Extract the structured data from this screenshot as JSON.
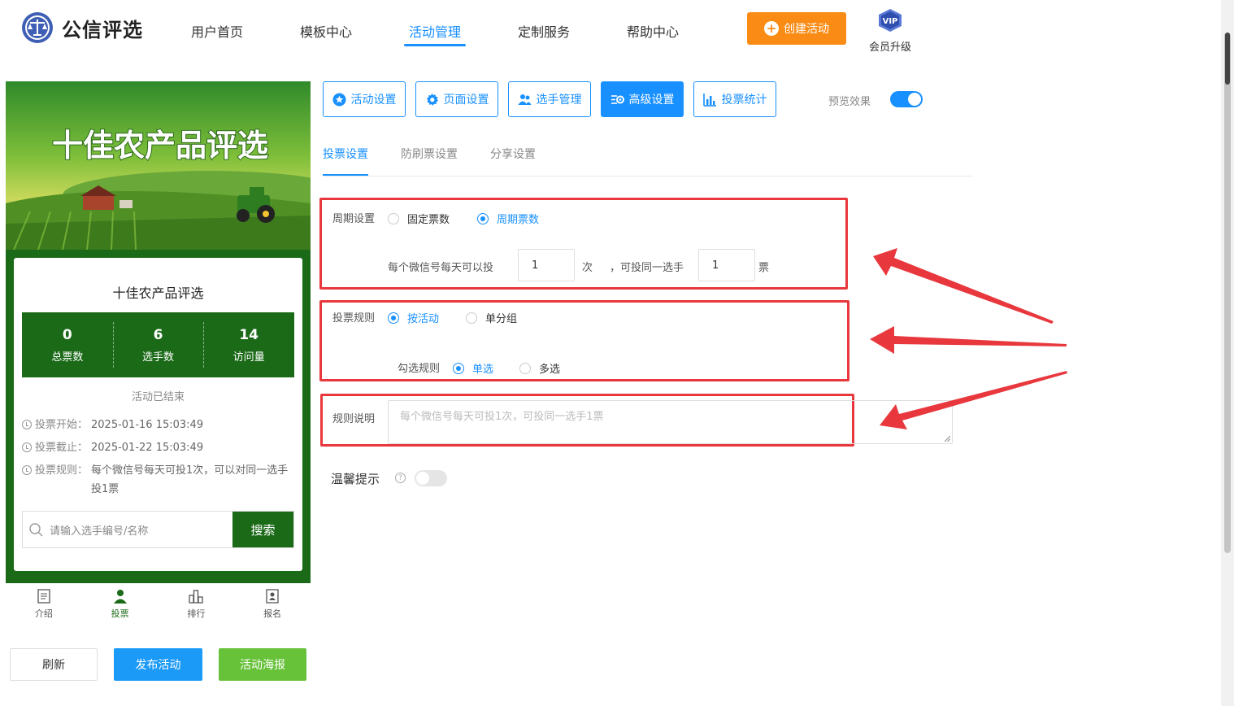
{
  "header": {
    "brand": "公信评选",
    "nav": [
      "用户首页",
      "模板中心",
      "活动管理",
      "定制服务",
      "帮助中心"
    ],
    "nav_active_index": 2,
    "create_button": "创建活动",
    "vip_badge": "VIP",
    "vip_label": "会员升级"
  },
  "preview": {
    "banner_title": "十佳农产品评选",
    "card_title": "十佳农产品评选",
    "stats": [
      {
        "value": "0",
        "label": "总票数"
      },
      {
        "value": "6",
        "label": "选手数"
      },
      {
        "value": "14",
        "label": "访问量"
      }
    ],
    "status": "活动已结束",
    "info": [
      {
        "label": "投票开始：",
        "value": "2025-01-16 15:03:49"
      },
      {
        "label": "投票截止：",
        "value": "2025-01-22 15:03:49"
      },
      {
        "label": "投票规则：",
        "value": "每个微信号每天可投1次，可以对同一选手投1票"
      }
    ],
    "search_placeholder": "请输入选手编号/名称",
    "search_button": "搜索",
    "tabbar": [
      "介绍",
      "投票",
      "排行",
      "报名"
    ],
    "tabbar_active_index": 1
  },
  "bottom_buttons": {
    "refresh": "刷新",
    "publish": "发布活动",
    "poster": "活动海报"
  },
  "settings": {
    "buttons": [
      "活动设置",
      "页面设置",
      "选手管理",
      "高级设置",
      "投票统计"
    ],
    "active_button_index": 3,
    "preview_label": "预览效果",
    "preview_on": true,
    "subtabs": [
      "投票设置",
      "防刷票设置",
      "分享设置"
    ],
    "active_subtab_index": 0,
    "cycle": {
      "label": "周期设置",
      "options": [
        "固定票数",
        "周期票数"
      ],
      "selected": "周期票数",
      "sentence_prefix": "每个微信号每天可以投",
      "times_value": "1",
      "times_unit": "次",
      "sentence_middle": "，可投同一选手",
      "votes_value": "1",
      "votes_unit": "票"
    },
    "rule": {
      "label": "投票规则",
      "options": [
        "按活动",
        "单分组"
      ],
      "selected": "按活动",
      "check_label": "勾选规则",
      "check_options": [
        "单选",
        "多选"
      ],
      "check_selected": "单选"
    },
    "description": {
      "label": "规则说明",
      "placeholder": "每个微信号每天可投1次，可投同一选手1票"
    },
    "warm_tip": {
      "label": "温馨提示",
      "enabled": false
    }
  },
  "colors": {
    "accent": "#1890ff",
    "orange": "#fa8c16",
    "green_dark": "#1b6a18",
    "green_light": "#67c23a",
    "annotation_red": "#e8383d"
  }
}
